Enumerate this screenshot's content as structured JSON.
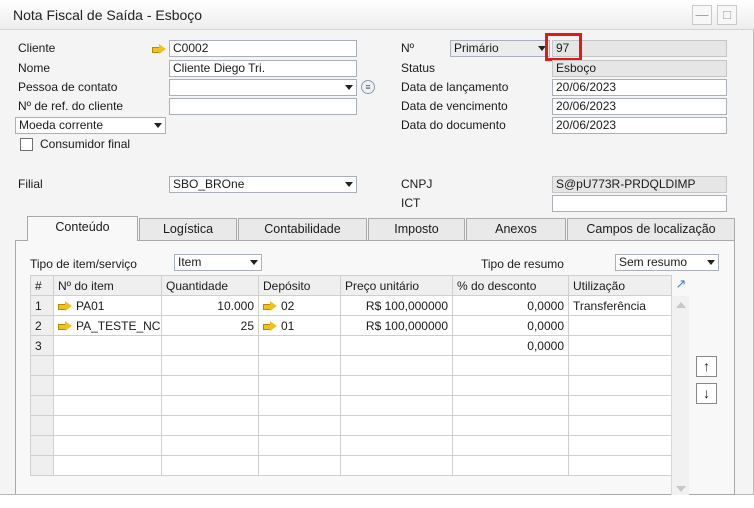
{
  "window": {
    "title": "Nota Fiscal de Saída - Esboço"
  },
  "header_left": {
    "cliente_label": "Cliente",
    "cliente_value": "C0002",
    "nome_label": "Nome",
    "nome_value": "Cliente Diego Tri.",
    "contato_label": "Pessoa de contato",
    "contato_value": "",
    "ref_label": "Nº de ref. do cliente",
    "ref_value": "",
    "moeda_label": "Moeda corrente",
    "consumidor_label": "Consumidor final",
    "filial_label": "Filial",
    "filial_value": "SBO_BROne"
  },
  "header_right": {
    "numero_label": "Nº",
    "serie_value": "Primário",
    "numero_value": "97",
    "status_label": "Status",
    "status_value": "Esboço",
    "lancamento_label": "Data de lançamento",
    "lancamento_value": "20/06/2023",
    "vencimento_label": "Data de vencimento",
    "vencimento_value": "20/06/2023",
    "documento_label": "Data do documento",
    "documento_value": "20/06/2023",
    "cnpj_label": "CNPJ",
    "cnpj_value": "S@pU773R-PRDQLDIMP",
    "ict_label": "ICT",
    "ict_value": ""
  },
  "tabs": [
    "Conteúdo",
    "Logística",
    "Contabilidade",
    "Imposto",
    "Anexos",
    "Campos de localização"
  ],
  "content": {
    "tipo_item_label": "Tipo de item/serviço",
    "tipo_item_value": "Item",
    "tipo_resumo_label": "Tipo de resumo",
    "tipo_resumo_value": "Sem resumo",
    "columns": [
      "#",
      "Nº do item",
      "Quantidade",
      "Depósito",
      "Preço unitário",
      "% do desconto",
      "Utilização"
    ],
    "rows": [
      {
        "n": "1",
        "item": "PA01",
        "qtd": "10.000",
        "dep": "02",
        "preco": "R$ 100,000000",
        "desc": "0,0000",
        "util": "Transferência"
      },
      {
        "n": "2",
        "item": "PA_TESTE_NC",
        "qtd": "25",
        "dep": "01",
        "preco": "R$ 100,000000",
        "desc": "0,0000",
        "util": ""
      },
      {
        "n": "3",
        "item": "",
        "qtd": "",
        "dep": "",
        "preco": "",
        "desc": "0,0000",
        "util": ""
      }
    ]
  },
  "colors": {
    "highlight": "#e0191b",
    "link_arrow": "#f0c020"
  }
}
